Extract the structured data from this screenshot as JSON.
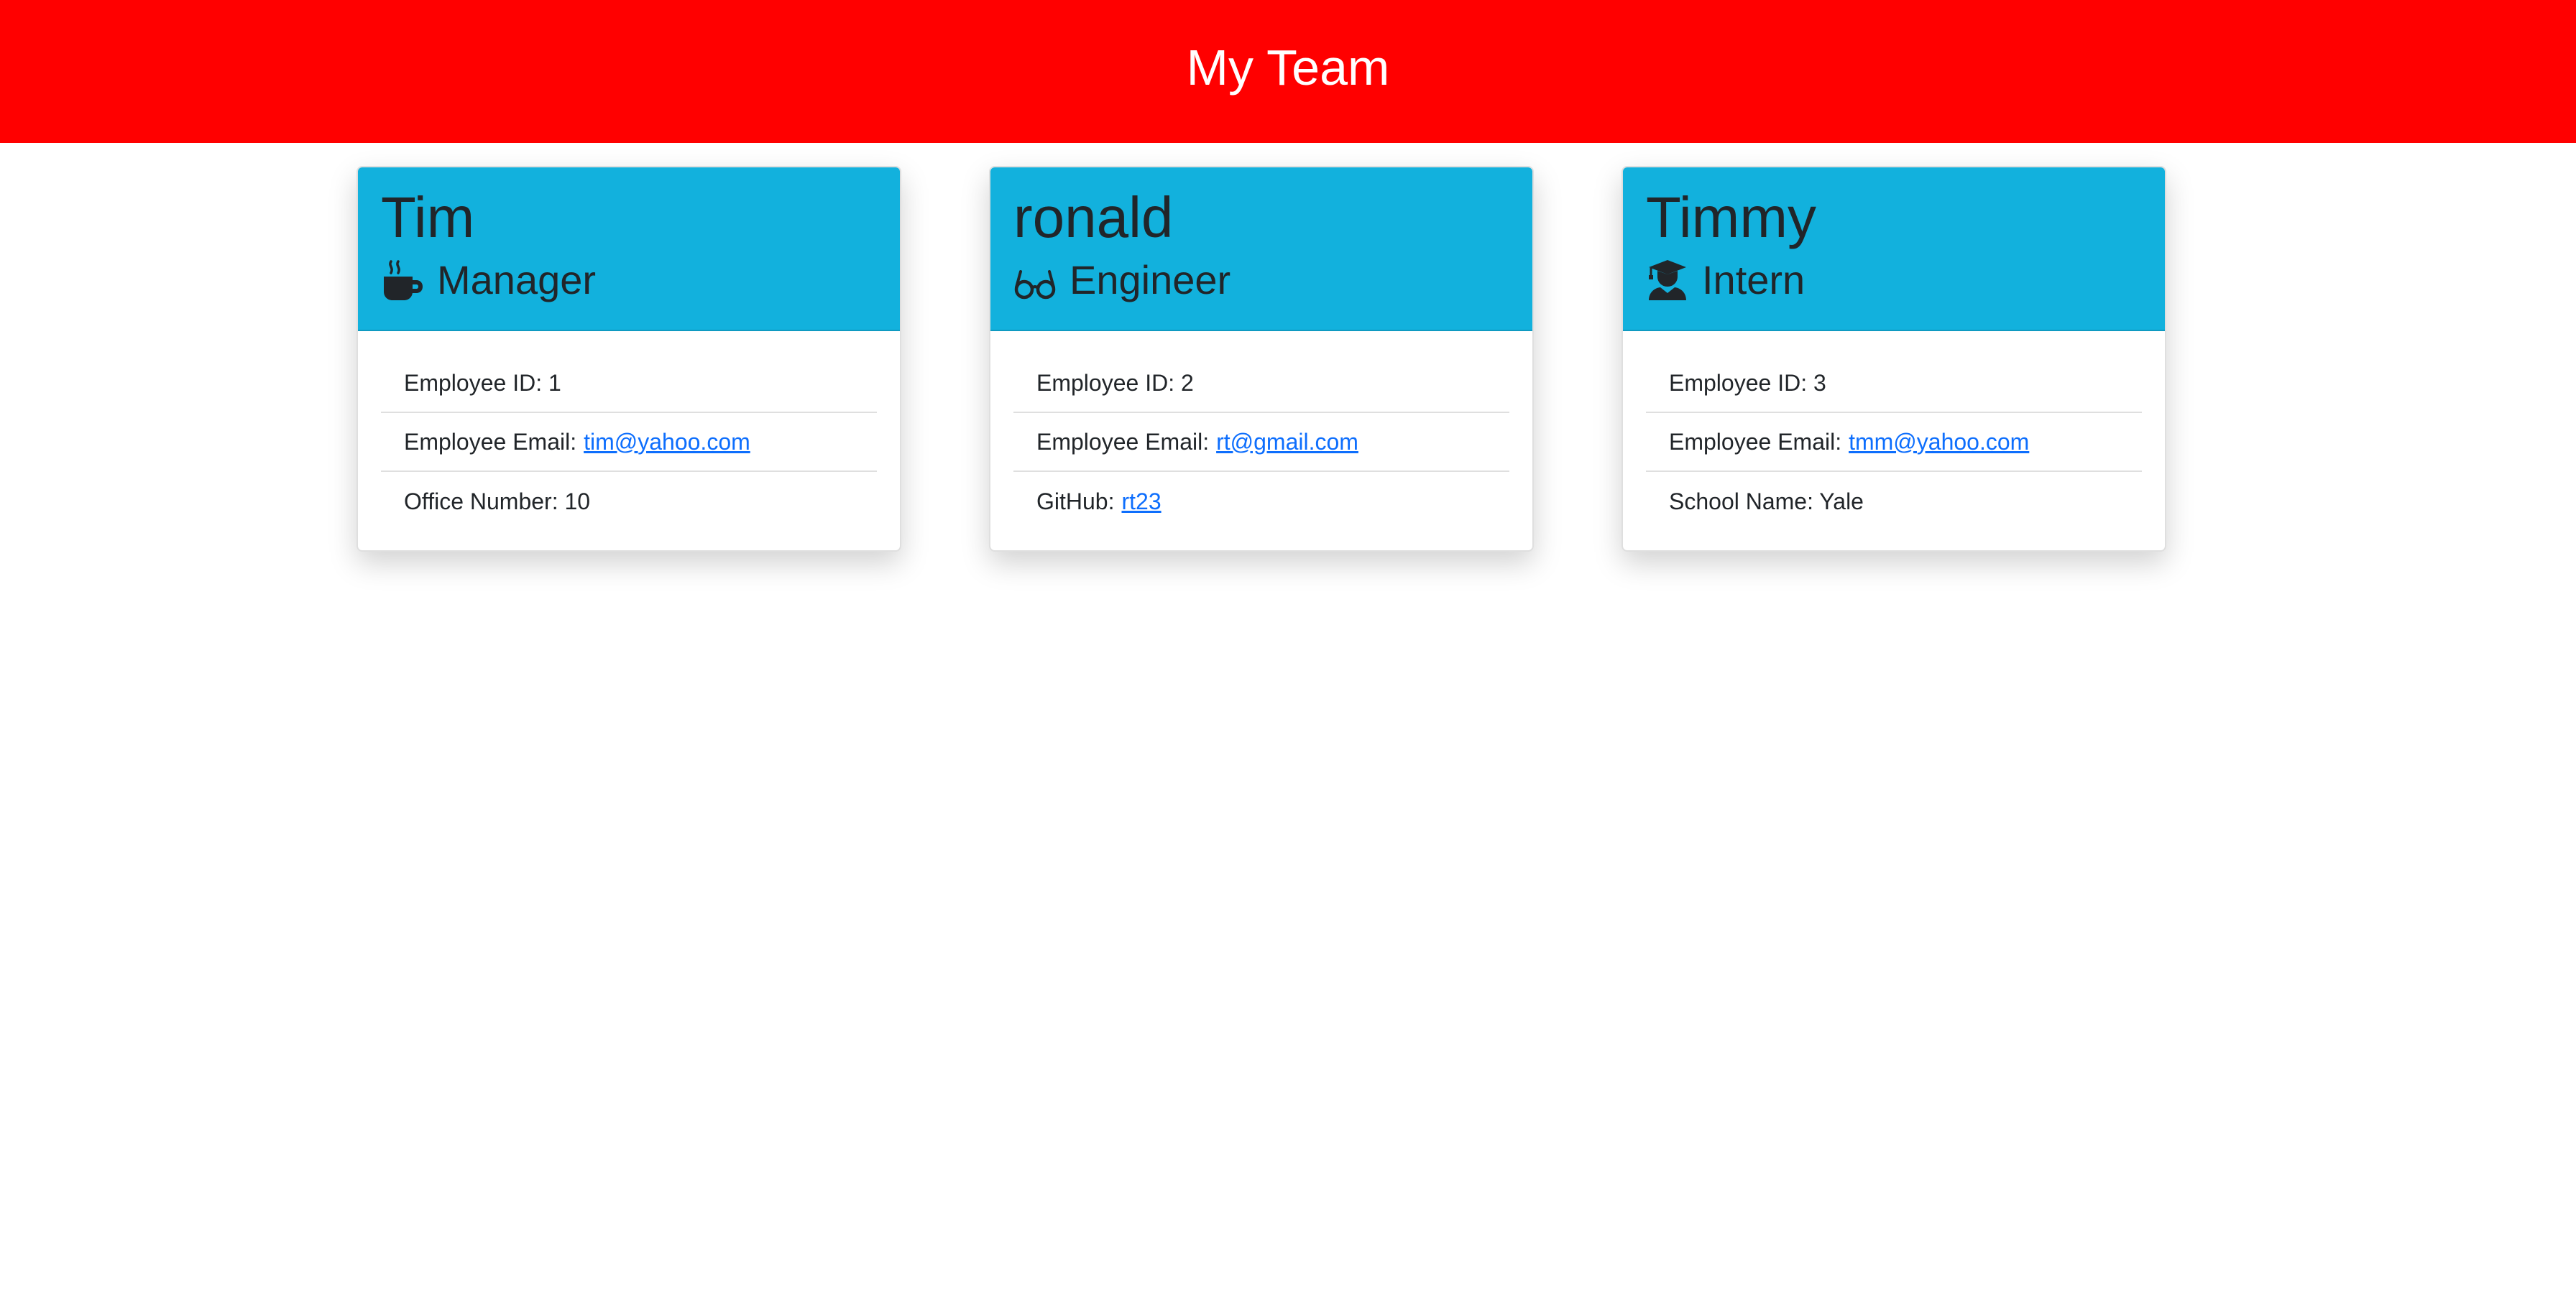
{
  "header": {
    "title": "My Team"
  },
  "employees": [
    {
      "name": "Tim",
      "role": "Manager",
      "icon": "coffee-icon",
      "id_label": "Employee ID: 1",
      "email_label": "Employee Email:",
      "email": "tim@yahoo.com",
      "extra_label": "Office Number: 10"
    },
    {
      "name": "ronald",
      "role": "Engineer",
      "icon": "glasses-icon",
      "id_label": "Employee ID: 2",
      "email_label": "Employee Email:",
      "email": "rt@gmail.com",
      "extra_label": "GitHub:",
      "extra_link": "rt23"
    },
    {
      "name": "Timmy",
      "role": "Intern",
      "icon": "graduate-icon",
      "id_label": "Employee ID: 3",
      "email_label": "Employee Email:",
      "email": "tmm@yahoo.com",
      "extra_label": "School Name: Yale"
    }
  ],
  "colors": {
    "header_bg": "#ff0000",
    "card_header_bg": "#12b1dd",
    "link": "#0d6efd"
  }
}
